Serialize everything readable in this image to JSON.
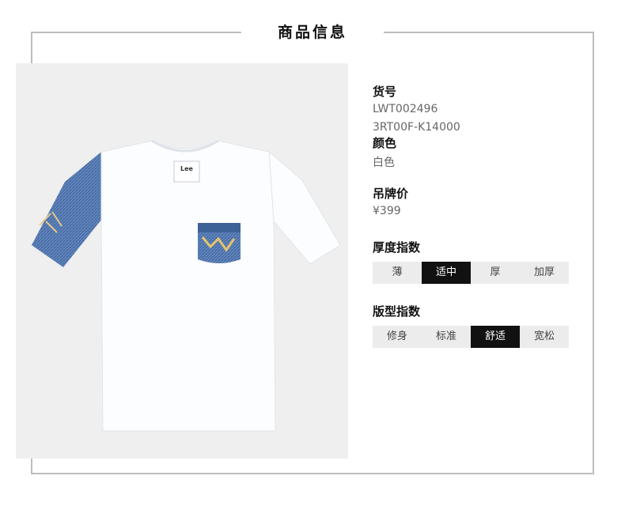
{
  "section_title": "商品信息",
  "product": {
    "item_no_label": "货号",
    "item_no_1": "LWT002496",
    "item_no_2": "3RT00F-K14000",
    "color_label": "颜色",
    "color_value": "白色",
    "price_label": "吊牌价",
    "price_value": "¥399",
    "thickness_label": "厚度指数",
    "thickness_options": [
      "薄",
      "适中",
      "厚",
      "加厚"
    ],
    "thickness_selected": 1,
    "fit_label": "版型指数",
    "fit_options": [
      "修身",
      "标准",
      "舒适",
      "宽松"
    ],
    "fit_selected": 2
  },
  "image": {
    "neck_label_brand": "Lee",
    "colors": {
      "shirt": "#fbfdfe",
      "denim": "#4f74ad",
      "background": "#efefef",
      "selected": "#111111",
      "segment_bg": "#ececec"
    }
  }
}
